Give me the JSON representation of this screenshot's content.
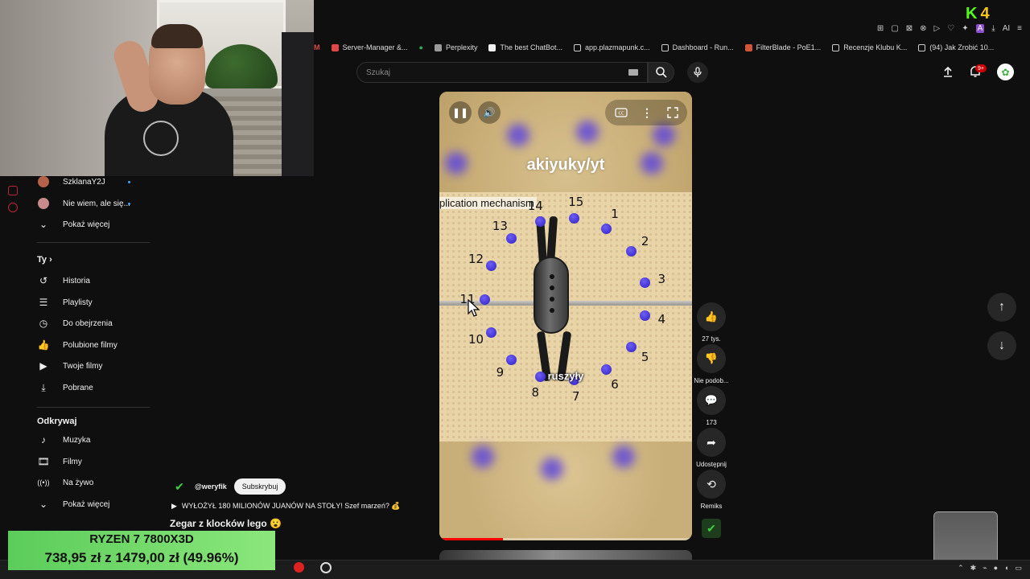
{
  "browser": {
    "bookmarks": [
      {
        "label": "Server-Manager &...",
        "color": "#e04848"
      },
      {
        "label": "Perplexity",
        "color": "#9a9a9a"
      },
      {
        "label": "The best ChatBot...",
        "color": "#f0f0f0"
      },
      {
        "label": "app.plazmapunk.c...",
        "color": "#cccccc"
      },
      {
        "label": "Dashboard - Run...",
        "color": "#cccccc"
      },
      {
        "label": "FilterBlade - PoE1...",
        "color": "#d2553b"
      },
      {
        "label": "Recenzje Klubu K...",
        "color": "#cccccc"
      },
      {
        "label": "(94) Jak Zrobić 10...",
        "color": "#cccccc"
      }
    ],
    "ext_label": "AI"
  },
  "overlay": {
    "k4_text": "K 4",
    "price_line1": "RYZEN 7 7800X3D",
    "price_line2": "738,95 zł z 1479,00 zł (49.96%)"
  },
  "header": {
    "search_placeholder": "Szukaj",
    "notification_badge": "9+"
  },
  "sidebar": {
    "subscriptions": [
      {
        "label": "SzklanaY2J",
        "avatar_color": "#b5624a"
      },
      {
        "label": "Nie wiem, ale się...",
        "avatar_color": "#c98a8a"
      }
    ],
    "show_more_1": "Pokaż więcej",
    "you_heading": "Ty",
    "you_items": [
      {
        "label": "Historia",
        "icon": "history-icon"
      },
      {
        "label": "Playlisty",
        "icon": "playlists-icon"
      },
      {
        "label": "Do obejrzenia",
        "icon": "watch-later-icon"
      },
      {
        "label": "Polubione filmy",
        "icon": "liked-icon"
      },
      {
        "label": "Twoje filmy",
        "icon": "your-videos-icon"
      },
      {
        "label": "Pobrane",
        "icon": "downloads-icon"
      }
    ],
    "explore_heading": "Odkrywaj",
    "explore_items": [
      {
        "label": "Muzyka",
        "icon": "music-icon"
      },
      {
        "label": "Filmy",
        "icon": "movies-icon"
      },
      {
        "label": "Na żywo",
        "icon": "live-icon"
      }
    ],
    "show_more_2": "Pokaż więcej"
  },
  "short": {
    "watermark": "akiyuky/yt",
    "mechanism_label": "plication mechanism",
    "caption": "ruszyły",
    "clock_numbers": [
      "15",
      "1",
      "2",
      "3",
      "4",
      "5",
      "6",
      "7",
      "8",
      "9",
      "10",
      "11",
      "12",
      "13",
      "14"
    ],
    "progress": 0.25
  },
  "actions": {
    "likes": "27 tys.",
    "dislike_label": "Nie podob...",
    "comments": "173",
    "share_label": "Udostępnij",
    "remix_label": "Remiks"
  },
  "info": {
    "channel": "@weryfik",
    "subscribe_label": "Subskrybuj",
    "playlist_title": "WYŁOŻYŁ 180 MILIONÓW JUANÓW NA STOŁY! Szef marzeń? 💰",
    "title": "Zegar z klocków lego 😮"
  },
  "colors": {
    "accent_red": "#ff0000",
    "stud_blue": "#3b2ad8",
    "background": "#0f0f0f"
  }
}
